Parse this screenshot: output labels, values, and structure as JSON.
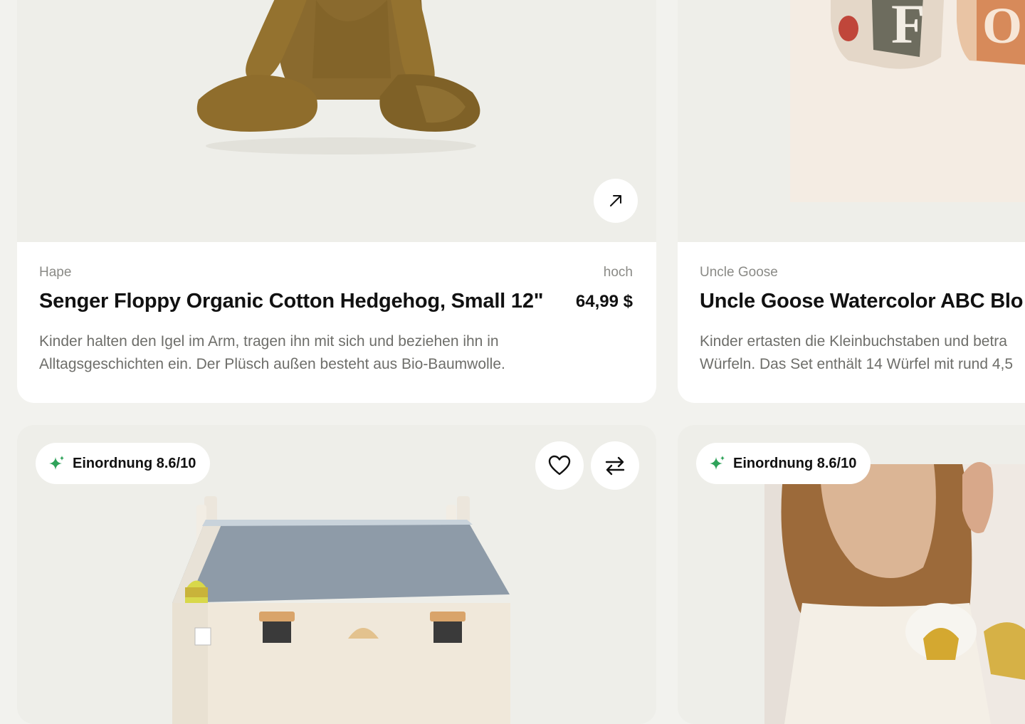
{
  "products": [
    {
      "brand": "Hape",
      "age_label": "hoch",
      "title": "Senger Floppy Organic Cotton Hedgehog, Small 12\"",
      "price": "64,99 $",
      "description": "Kinder halten den Igel im Arm, tragen ihn mit sich und beziehen ihn in Alltagsgeschichten ein. Der Plüsch außen besteht aus Bio-Baumwolle.",
      "image_icon": "plush-toy-image"
    },
    {
      "brand": "Uncle Goose",
      "title": "Uncle Goose Watercolor ABC Blo",
      "description_lines": [
        "Kinder ertasten die Kleinbuchstaben und betra",
        "Würfeln. Das Set enthält 14 Würfel mit rund 4,5"
      ],
      "image_icon": "alphabet-blocks-image"
    },
    {
      "rating_label": "Einordnung 8.6/10",
      "image_icon": "dollhouse-image"
    },
    {
      "rating_label": "Einordnung 8.6/10",
      "image_icon": "person-photo-image"
    }
  ],
  "icons": {
    "open": "arrow-up-right-icon",
    "favorite": "heart-icon",
    "compare": "compare-arrows-icon",
    "rating": "sparkle-icon"
  },
  "colors": {
    "background": "#f2f2ee",
    "card_media": "#eeeee9",
    "card_info": "#ffffff",
    "muted_text": "#8a8a86",
    "accent_green": "#2fa35a"
  }
}
